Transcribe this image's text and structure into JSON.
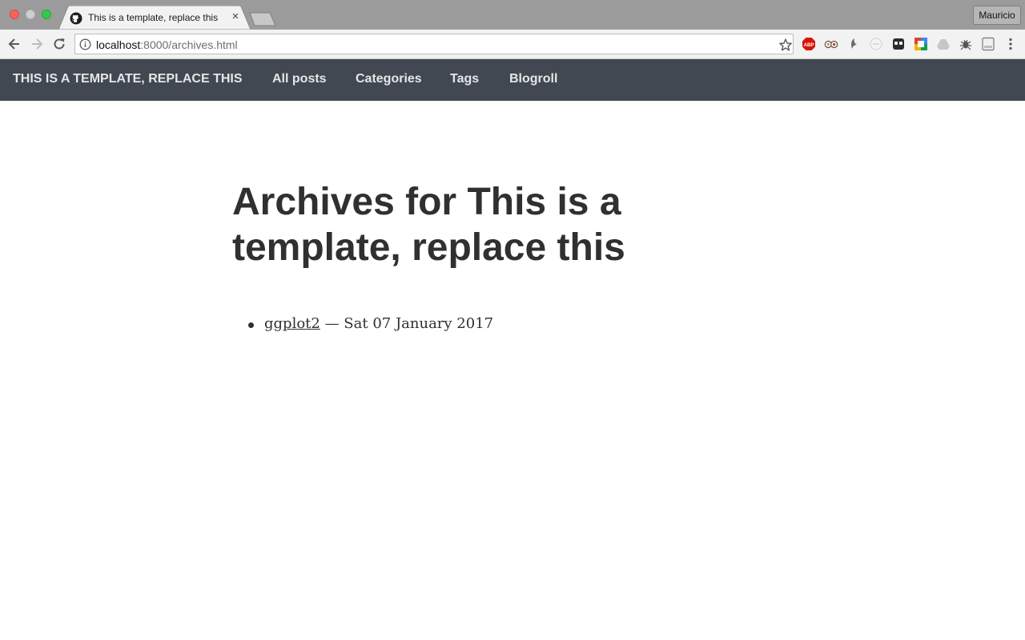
{
  "browser": {
    "tab": {
      "title": "This is a template, replace this",
      "close_glyph": "×"
    },
    "profile": "Mauricio",
    "address": {
      "host": "localhost",
      "rest": ":8000/archives.html"
    },
    "extensions": [
      "adblock-plus-icon",
      "tripadvisor-icon",
      "dolphin-icon",
      "page-icon",
      "ghostery-icon",
      "google-translate-icon",
      "drive-icon",
      "bug-icon",
      "document-icon",
      "kebab-menu-icon"
    ]
  },
  "site_nav": {
    "brand": "THIS IS A TEMPLATE, REPLACE THIS",
    "links": [
      "All posts",
      "Categories",
      "Tags",
      "Blogroll"
    ]
  },
  "page": {
    "title": "Archives for This is a template, replace this",
    "entries": [
      {
        "link": "ggplot2",
        "date": " — Sat 07 January 2017"
      }
    ]
  },
  "colors": {
    "navbar_bg": "#424851",
    "text": "#303030",
    "tabstrip": "#9b9b9b"
  }
}
